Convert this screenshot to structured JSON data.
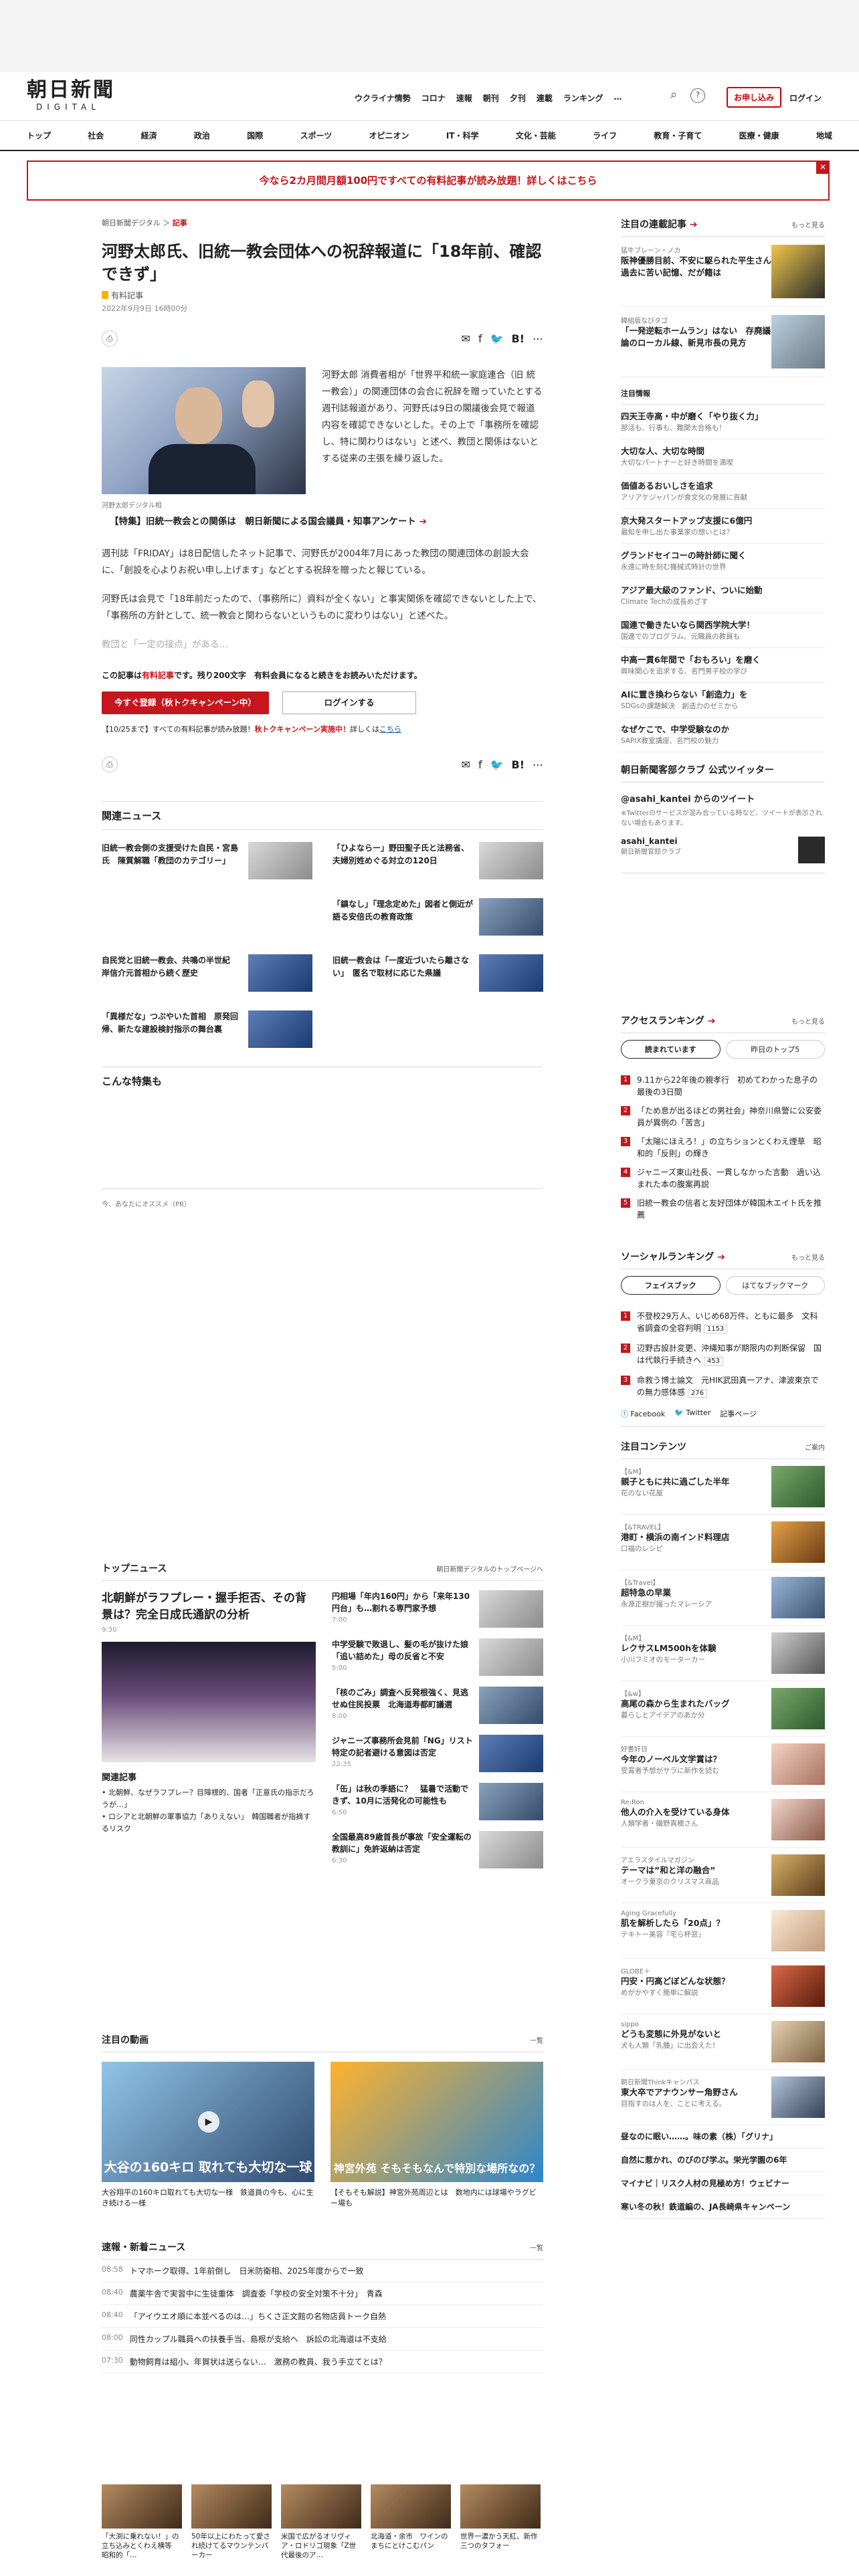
{
  "header": {
    "logo_main": "朝日新聞",
    "logo_sub": "DIGITAL",
    "nav": [
      "ウクライナ情勢",
      "コロナ",
      "速報",
      "朝刊",
      "夕刊",
      "連載",
      "ランキング",
      "…"
    ],
    "apply": "お申し込み",
    "login": "ログイン"
  },
  "sections": [
    "トップ",
    "社会",
    "経済",
    "政治",
    "国際",
    "スポーツ",
    "オピニオン",
    "IT・科学",
    "文化・芸能",
    "ライフ",
    "教育・子育て",
    "医療・健康",
    "地域"
  ],
  "banner": "今なら2カ月間月額100円ですべての有料記事が読み放題！詳しくはこちら",
  "article": {
    "crumb_site": "朝日新聞デジタル",
    "crumb_section": "記事",
    "title": "河野太郎氏、旧統一教会団体への祝辞報道に「18年前、確認できず」",
    "tag": "有料記事",
    "date": "2022年9月9日 16時00分",
    "caption": "河野太郎デジタル相",
    "p1": "河野太郎 消費者相が「世界平和統一家庭連合（旧 統一教会）」の関連団体の会合に祝辞を贈っていたとする週刊誌報道があり、河野氏は9日の閣議後会見で報道内容を確認できないとした。その上で「事務所を確認し、特に関わりはない」と述べ、教団と関係はないとする従来の主張を繰り返した。",
    "feature": "【特集】旧統一教会との関係は　朝日新聞による国会議員・知事アンケート",
    "p2": "週刊誌「FRIDAY」は8日配信したネット記事で、河野氏が2004年7月にあった教団の関連団体の創設大会に、「創設を心よりお祝い申し上げます」などとする祝辞を贈ったと報じている。",
    "p3": "河野氏は会見で「18年前だったので、（事務所に）資料が全くない」と事実関係を確認できないとした上で、「事務所の方針として、統一教会と関わらないというものに変わりはない」と述べた。",
    "p4": "教団と「一定の接点」がある…",
    "notice_pre": "この記事は",
    "notice_tag": "有料記事",
    "notice_post": "です。残り200文字　有料会員になると続きをお読みいただけます。",
    "btn_register": "今すぐ登録（秋トクキャンペーン中）",
    "btn_login": "ログインする",
    "promo_pre": "【10/25まで】すべての有料記事が読み放題！",
    "promo_red": "秋トクキャンペーン実施中！",
    "promo_post": "詳しくは",
    "promo_link": "こちら"
  },
  "related": {
    "title": "関連ニュース",
    "items": [
      "旧統一教会側の支援受けた自民・宮島氏　陳質解職「教団のカテゴリー」",
      "「ひよならー」野田聖子氏と法務省、夫婦別姓めぐる対立の120日",
      "「鎮なし」「理念定めた」図者と側近が語る安倍氏の教育政策",
      "自民党と旧統一教会、共鳴の半世紀　岸信介元首相から続く歴史",
      "旧統一教会は「一度近づいたら離さない」　匿名で取材に応じた県議",
      "「異様だな」つぶやいた首相　原発回帰、新たな建設検討指示の舞台裏"
    ],
    "special": "こんな特集も",
    "pr": "今、あなたにオススメ（PR）"
  },
  "topnews": {
    "title": "トップニュース",
    "more": "朝日新聞デジタルのトップページへ",
    "lead": "北朝鮮がラフプレー・握手拒否、その背景は？完全日成氏通訳の分析",
    "lead_time": "9:30",
    "related_title": "関連記事",
    "related": [
      "北朝鮮、なぜラフプレー？目障標的、国者「正意氏の指示だろうが…」",
      "ロシアと北朝鮮の軍事協力「ありえない」　韓国職者が指摘するリスク"
    ],
    "items": [
      {
        "t": "円相場「年内160円」から「来年130円台」も…割れる専門家予想",
        "tm": "7:00"
      },
      {
        "t": "中学受験で敗退し、髪の毛が抜けた娘　「追い詰めた」母の反省と不安",
        "tm": "5:00"
      },
      {
        "t": "「核のごみ」調査へ反発根強く、見逃せぬ住民投票　北海道寿都町議選",
        "tm": "8:00"
      },
      {
        "t": "ジャニーズ事務所会見前「NG」リスト　特定の記者避ける意図は否定",
        "tm": "22:35"
      },
      {
        "t": "「缶」は秋の季語に？　猛暑で活動できず、10月に活発化の可能性も",
        "tm": "6:50"
      },
      {
        "t": "全国最高89歳首長が事故「安全運転の教訓に」免許返納は否定",
        "tm": "6:30"
      }
    ]
  },
  "video": {
    "title": "注目の動画",
    "more": "一覧",
    "items": [
      "大谷翔平の160キロ取れても大切な一様　鉄道員の今も、心に生き続ける一様",
      "【そもそも解説】神宮外苑周辺とは　数地内には球場やラグビー場も"
    ],
    "overlay1": "大谷の160キロ 取れても大切な一球",
    "overlay2": "神宮外苑 そもそもなんで特別な場所なの？"
  },
  "flash": {
    "title": "速報・新着ニュース",
    "more": "一覧",
    "items": [
      {
        "tm": "08:58",
        "t": "トマホーク取得、1年前倒し　日米防衛相、2025年度からで一致"
      },
      {
        "tm": "08:40",
        "t": "農薬牛舎で実習中に生徒重体　調査委「学校の安全対策不十分」　青森"
      },
      {
        "tm": "08:40",
        "t": "「アイウエオ順に本並べるのは…」ちくさ正文館の名物店員トーク自熱"
      },
      {
        "tm": "08:00",
        "t": "同性カップル職員への扶養手当、島根が支給へ　訴訟の北海道は不支給"
      },
      {
        "tm": "07:30",
        "t": "動物飼育は組小、年賀状は送らない…　激務の教員、我う手立てとは？"
      }
    ]
  },
  "strip": [
    "「大渕に乗れない！」の立ち込みとくわえ横等　昭和的「…",
    "50年以上にわたって愛され続けてるマウンテンパーカー",
    "米国で広がるオリヴィア・ロドリゴ現象「Z世代最後のア…",
    "北海道・余市　ワインのまちにとけこむパン",
    "世界一濃かう天紅、新作三つのタフォー"
  ],
  "side": {
    "serial": {
      "title": "注目の連載記事",
      "more": "もっと見る",
      "items": [
        {
          "k": "猛牛ブレーン・ノカ",
          "t": "阪神優勝目前、不安に駆られた平生さん　過去に苦い記憶、だが籍は"
        },
        {
          "k": "韓組版なびタゴ",
          "t": "「一発逆転ホームラン」はない　存廃議論のローカル線、新見市長の見方"
        }
      ]
    },
    "note_title": "注目情報",
    "notes": [
      {
        "t": "四天王寺高・中が磨く「やり抜く力」",
        "s": "部活も、行事も、難関大合格も！"
      },
      {
        "t": "大切な人、大切な時間",
        "s": "大切なパートナーと好き時間を満喫"
      },
      {
        "t": "価値あるおいしさを追求",
        "s": "アリアケジャパンが食文化の発展に貢献"
      },
      {
        "t": "京大発スタートアップ支援に6億円",
        "s": "最知を申し出た事業家の想いとは？"
      },
      {
        "t": "グランドセイコーの時計師に聞く",
        "s": "永遠に時を刻む機械式時計の世界"
      },
      {
        "t": "アジア最大級のファンド、ついに始動",
        "s": "Climate Techの成長めざす"
      },
      {
        "t": "国連で働きたいなら関西学院大学！",
        "s": "国連でのプログラム、元職員の教員も"
      },
      {
        "t": "中高一貫6年間で「おもろい」を磨く",
        "s": "興味関心を追求する、名門男子校の学び"
      },
      {
        "t": "AIに置き換わらない「創造力」を",
        "s": "SDGsの課題解決　創造力のゼミから"
      },
      {
        "t": "なぜケこで、中学受験なのか",
        "s": "SAPIX教室講座、名門校の魅力"
      }
    ],
    "twitter_title": "朝日新聞客部クラブ 公式ツイッター",
    "tw_from": "@asahi_kantei からのツイート",
    "tw_note": "※Twitterのサービスが混み合っている時など、ツイートが表示されない場合もあります。",
    "tw_name": "asahi_kantei",
    "tw_desc": "朝日新聞官邸クラブ",
    "access": {
      "title": "アクセスランキング",
      "more": "もっと見る",
      "tab1": "読まれています",
      "tab2": "昨日のトップ5",
      "items": [
        "9.11から22年後の親孝行　初めてわかった息子の最後の3日間",
        "「ため息が出るほどの男社会」神奈川県警に公安委員が異例の「苦言」",
        "「太陽にほえろ！」の立ちションとくわえ煙草　昭和的「反則」の輝き",
        "ジャニーズ東山社長、一貫しなかった言動　過い込まれた本の腹案再説",
        "旧統一教会の信者と友好団体が韓国木エイト氏を推薦"
      ]
    },
    "social": {
      "title": "ソーシャルランキング",
      "more": "もっと見る",
      "tab1": "フェイスブック",
      "tab2": "はてなブックマーク",
      "items": [
        {
          "t": "不登校29万人、いじめ68万件、ともに最多　文科省調査の全容判明",
          "c": "1153"
        },
        {
          "t": "辺野古設計変更、沖縄知事が期限内の判断保留　国は代執行手続きへ",
          "c": "453"
        },
        {
          "t": "命救う博士論文　元HIK武田真一アナ、津波東京での無力感体感",
          "c": "276"
        }
      ],
      "fb": "Facebook",
      "tw": "Twitter",
      "ref": "記事ページ"
    },
    "contents": {
      "title": "注目コンテンツ",
      "more": "ご案内",
      "items": [
        {
          "k": "【&M】",
          "t": "親子ともに共に過ごした半年",
          "s": "花のない花屋"
        },
        {
          "k": "【&TRAVEL】",
          "t": "港町・横浜の南インド料理店",
          "s": "口福のレシピ"
        },
        {
          "k": "【&Travel】",
          "t": "超特急の早業",
          "s": "永源正樹が撮ったマレーシア"
        },
        {
          "k": "【&M】",
          "t": "レクサスLM500hを体験",
          "s": "小川フミオのモーターカー"
        },
        {
          "k": "【&w】",
          "t": "高尾の森から生まれたバッグ",
          "s": "暮らしとアイデアのあか分"
        },
        {
          "k": "好書好日",
          "t": "今年のノーベル文学賞は？",
          "s": "受賞者予想がサラに新作を読む"
        },
        {
          "k": "Re:Ron",
          "t": "他人の介入を受けている身体",
          "s": "人類学者・磯野真穂さん"
        },
        {
          "k": "アエラスタイルマガジン",
          "t": "テーマは”和と洋の融合”",
          "s": "オークラ東京のクリスマス商品"
        },
        {
          "k": "Aging Gracefully",
          "t": "肌を解析したら「20点」？",
          "s": "テキトー美容「宅ら杯窓」"
        },
        {
          "k": "GLOBE＋",
          "t": "円安・円高どぼどんな状態？",
          "s": "めがかやすく簡単に解説"
        },
        {
          "k": "sippo",
          "t": "どうも変態に外見がないと",
          "s": "犬も人類「乳腫」に出会えた！"
        },
        {
          "k": "朝日新聞Thinkキャンパス",
          "t": "東大卒でアナウンサー角野さん",
          "s": "目指すのは人を、ことに考える。"
        }
      ],
      "extra": [
        "昼なのに眠い……。味の素（株）「グリナ」",
        "自然に惹かれ、のびのび学ぶ。栄光学園の6年",
        "マイナビ｜リスク人材の見極め方！ウェビナー",
        "寒い冬の秋！鉄道編の、JA長崎県キャンペーン"
      ]
    }
  }
}
